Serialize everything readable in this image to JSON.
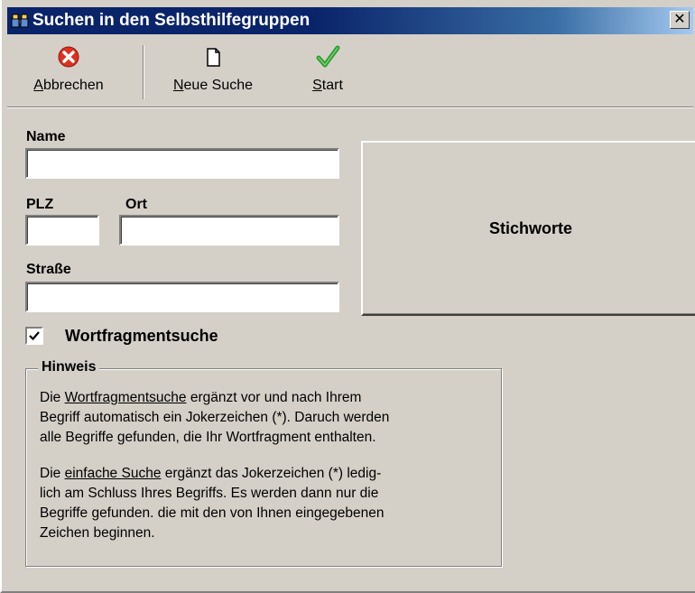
{
  "window": {
    "title": "Suchen in den Selbsthilfegruppen",
    "close_glyph": "✕"
  },
  "toolbar": {
    "cancel": {
      "prefix": "",
      "mnemonic": "A",
      "rest": "bbrechen",
      "icon": "cancel-icon"
    },
    "new_search": {
      "prefix": "",
      "mnemonic": "N",
      "rest": "eue Suche",
      "icon": "new-document-icon"
    },
    "start": {
      "prefix": "",
      "mnemonic": "S",
      "rest": "tart",
      "icon": "checkmark-icon"
    }
  },
  "form": {
    "name_label": "Name",
    "name_value": "",
    "plz_label": "PLZ",
    "plz_value": "",
    "ort_label": "Ort",
    "ort_value": "",
    "strasse_label": "Straße",
    "strasse_value": ""
  },
  "stichworte_button": "Stichworte",
  "wortfragment": {
    "label": "Wortfragmentsuche",
    "checked": true
  },
  "hinweis": {
    "title": "Hinweis",
    "p1_before": "Die ",
    "p1_link": "Wortfragmentsuche",
    "p1_after_line1": " ergänzt vor und nach Ihrem",
    "p1_line2": "Begriff automatisch ein Jokerzeichen (*). Daruch werden",
    "p1_line3": "alle Begriffe gefunden, die Ihr Wortfragment enthalten.",
    "p2_before": "Die ",
    "p2_link": "einfache Suche",
    "p2_after_line1": " ergänzt das Jokerzeichen (*) ledig-",
    "p2_line2": "lich am Schluss Ihres Begriffs. Es werden dann nur die",
    "p2_line3": "Begriffe gefunden. die mit den von Ihnen eingegebenen",
    "p2_line4": "Zeichen beginnen."
  },
  "colors": {
    "titlebar_start": "#0a246a",
    "titlebar_end": "#a6caf0",
    "face": "#d4d0c8",
    "cancel_red": "#e0301e",
    "start_green": "#2e9a2e"
  }
}
